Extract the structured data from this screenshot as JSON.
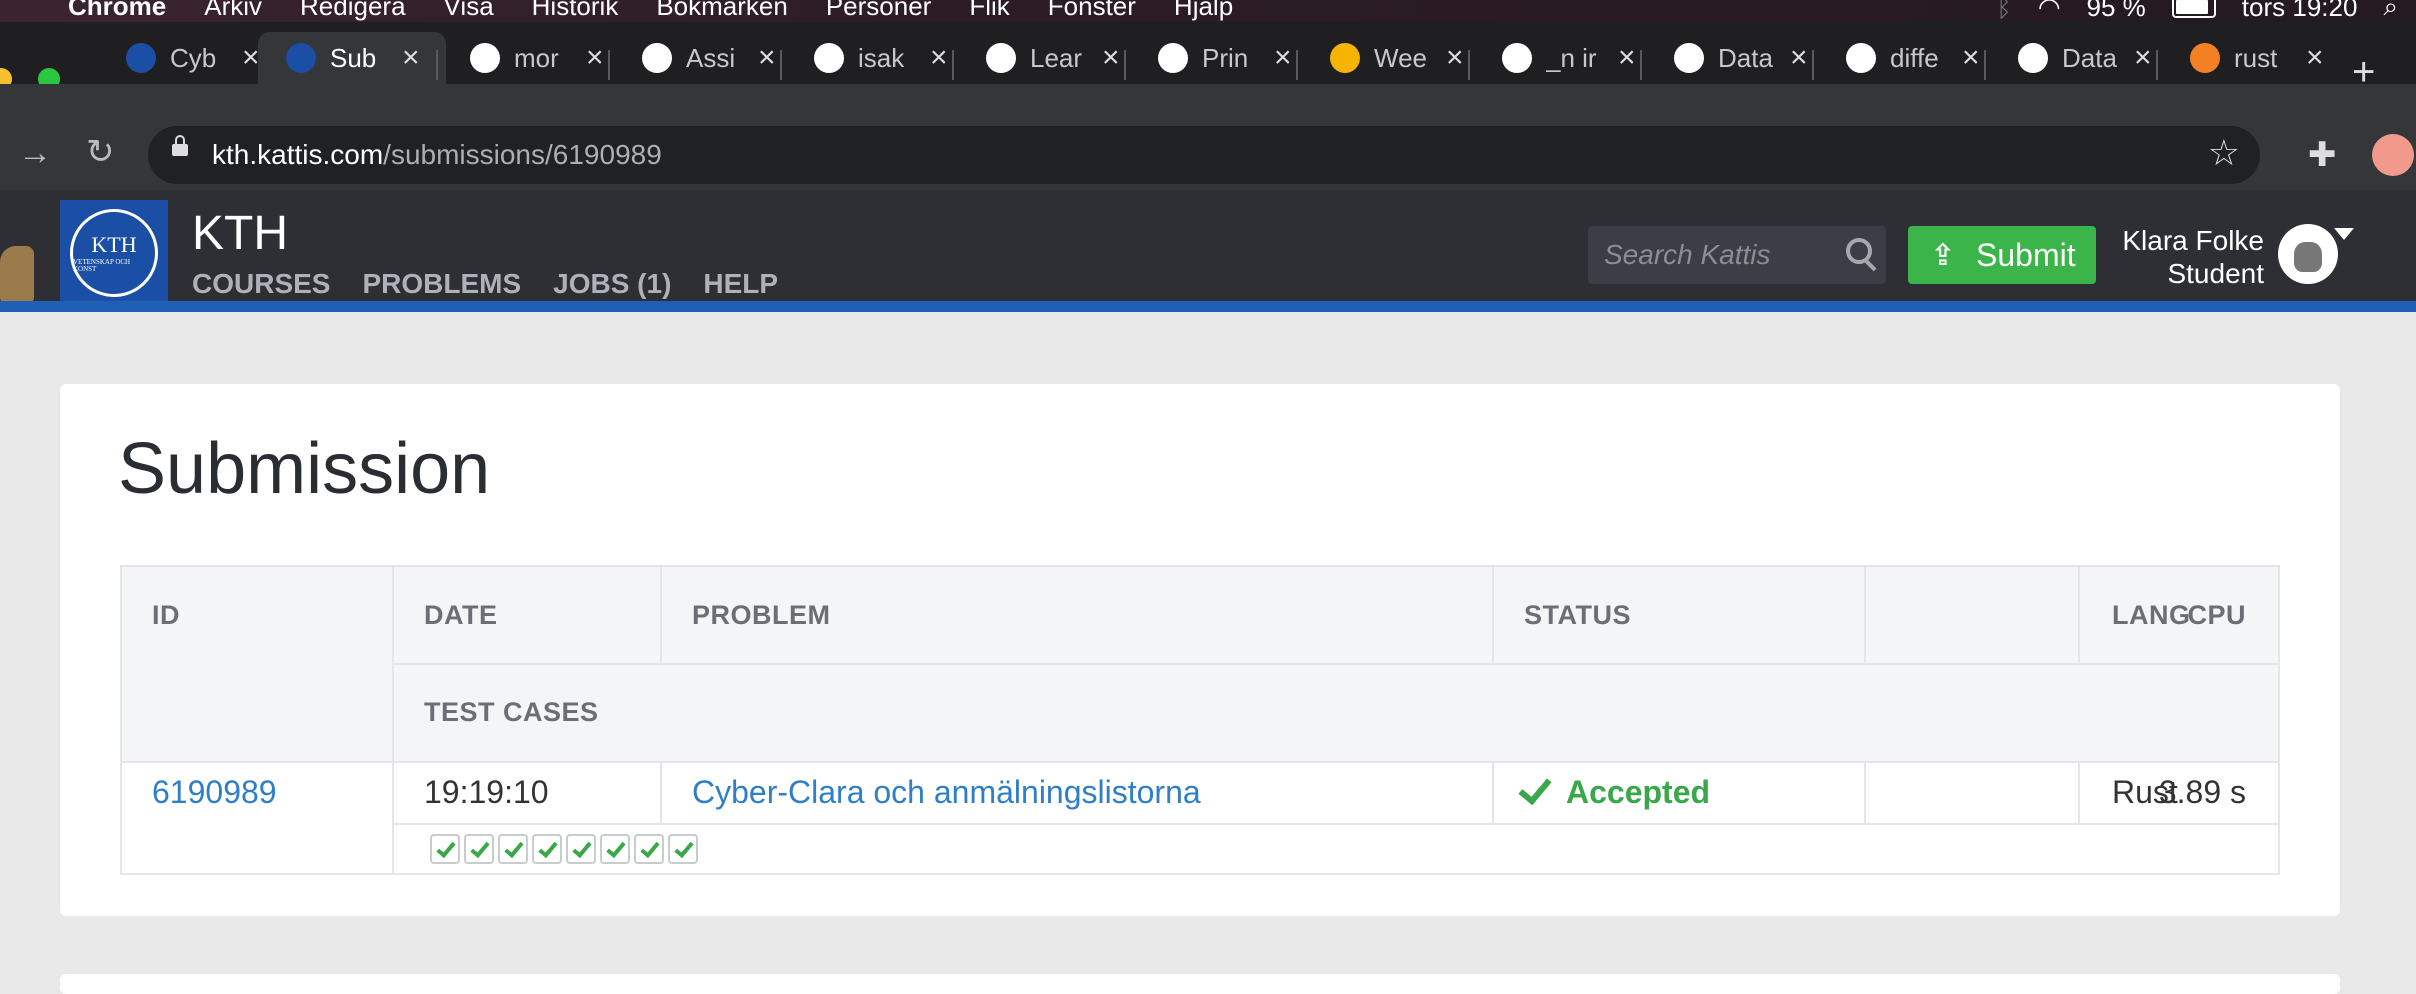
{
  "menubar": {
    "menus": [
      "Chrome",
      "Arkiv",
      "Redigera",
      "Visa",
      "Historik",
      "Bokmärken",
      "Personer",
      "Flik",
      "Fönster",
      "Hjälp"
    ],
    "battery": "95 %",
    "clock": "tors 19:20"
  },
  "tabs": [
    {
      "title": "Cyb",
      "icon": "kth-icon",
      "color": "#1b4ea5"
    },
    {
      "title": "Sub",
      "icon": "kth-icon",
      "color": "#1b4ea5",
      "active": true
    },
    {
      "title": "mor",
      "icon": "github-icon",
      "color": "#ffffff"
    },
    {
      "title": "Assi",
      "icon": "github-icon",
      "color": "#ffffff"
    },
    {
      "title": "isak",
      "icon": "github-icon",
      "color": "#ffffff"
    },
    {
      "title": "Lear",
      "icon": "rust-icon",
      "color": "#ffffff"
    },
    {
      "title": "Prin",
      "icon": "book-icon",
      "color": "#ffffff"
    },
    {
      "title": "Wee",
      "icon": "slides-icon",
      "color": "#f4b400"
    },
    {
      "title": "_n ir",
      "icon": "google-icon",
      "color": "#ffffff"
    },
    {
      "title": "Data",
      "icon": "book-icon",
      "color": "#ffffff"
    },
    {
      "title": "diffe",
      "icon": "google-icon",
      "color": "#ffffff"
    },
    {
      "title": "Data",
      "icon": "book-icon",
      "color": "#ffffff"
    },
    {
      "title": "rust",
      "icon": "stackoverflow-icon",
      "color": "#f48024"
    }
  ],
  "address": {
    "host": "kth.kattis.com",
    "path": "/submissions/6190989"
  },
  "site": {
    "title": "KTH",
    "logo_text": "KTH",
    "logo_subtext": "VETENSKAP OCH KONST",
    "nav": [
      "COURSES",
      "PROBLEMS",
      "JOBS (1)",
      "HELP"
    ],
    "search_placeholder": "Search Kattis",
    "submit_label": "Submit",
    "user_name": "Klara Folke",
    "user_role": "Student"
  },
  "page": {
    "heading": "Submission",
    "columns": {
      "id": "ID",
      "date": "DATE",
      "problem": "PROBLEM",
      "status": "STATUS",
      "cpu": "CPU",
      "lang": "LANG",
      "test_cases": "TEST CASES"
    },
    "submission": {
      "id": "6190989",
      "date": "19:19:10",
      "problem": "Cyber-Clara och anmälningslistorna",
      "status": "Accepted",
      "cpu": "3.89 s",
      "lang": "Rust",
      "test_cases_passed": 8
    }
  },
  "colors": {
    "accent_blue": "#2f7fc8",
    "accepted_green": "#3aa84a",
    "submit_green": "#3bb54a",
    "kth_blue": "#1b4ea5"
  }
}
